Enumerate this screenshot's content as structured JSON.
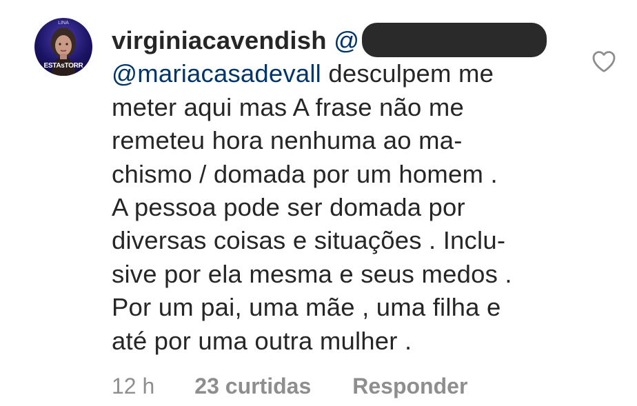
{
  "comment": {
    "avatar_text": "ESTAsTORR",
    "avatar_top_text": "LINA",
    "username": "virginiacavendish",
    "mention_prefix": "@",
    "reply_mention": "@mariacasadevall",
    "lines": [
      " desculpem me",
      "meter aqui mas A frase não me",
      "remeteu hora nenhuma ao ma-",
      "chismo / domada por um homem .",
      "A pessoa pode ser domada por",
      "diversas coisas e situações . Inclu-",
      "sive por ela mesma e seus medos .",
      "Por um pai, uma mãe , uma filha e",
      "até por uma outra mulher ."
    ],
    "time": "12 h",
    "likes": "23 curtidas",
    "reply_label": "Responder"
  },
  "icons": {
    "like": "heart-outline-icon"
  },
  "colors": {
    "text": "#262626",
    "mention": "#003569",
    "meta": "#8e8e8e",
    "redaction": "#2a2a2a"
  }
}
